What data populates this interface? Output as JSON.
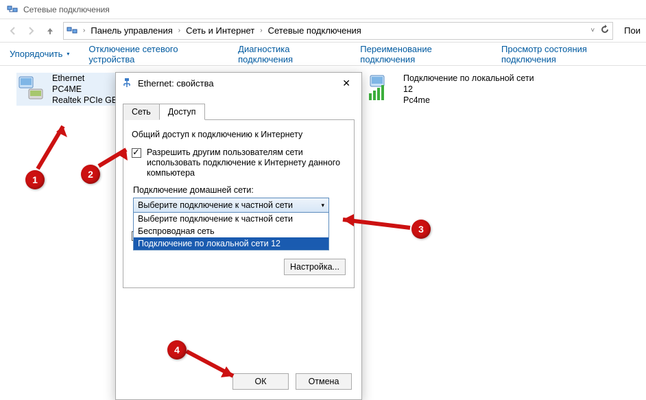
{
  "window": {
    "title": "Сетевые подключения"
  },
  "breadcrumb": {
    "root": "Панель управления",
    "mid": "Сеть и Интернет",
    "leaf": "Сетевые подключения"
  },
  "search_cut": "Пои",
  "toolbar": {
    "organize": "Упорядочить",
    "disable": "Отключение сетевого устройства",
    "diagnose": "Диагностика подключения",
    "rename": "Переименование подключения",
    "status": "Просмотр состояния подключения"
  },
  "adapters": {
    "ethernet": {
      "name": "Ethernet",
      "line2": "PC4ME",
      "line3": "Realtek PCIe GBE"
    },
    "lan12": {
      "name": "Подключение по локальной сети",
      "line2": "12",
      "line3": "Pc4me"
    }
  },
  "dialog": {
    "title": "Ethernet: свойства",
    "tab_network": "Сеть",
    "tab_access": "Доступ",
    "section": "Общий доступ к подключению к Интернету",
    "chk_share": "Разрешить другим пользователям сети использовать подключение к Интернету данного компьютера",
    "home_net_label": "Подключение домашней сети:",
    "combo_selected": "Выберите подключение к частной сети",
    "combo_options": [
      "Выберите подключение к частной сети",
      "Беспроводная сеть",
      "Подключение по локальной сети 12"
    ],
    "settings_btn": "Настройка...",
    "ok": "ОК",
    "cancel": "Отмена"
  },
  "markers": {
    "m1": "1",
    "m2": "2",
    "m3": "3",
    "m4": "4"
  }
}
